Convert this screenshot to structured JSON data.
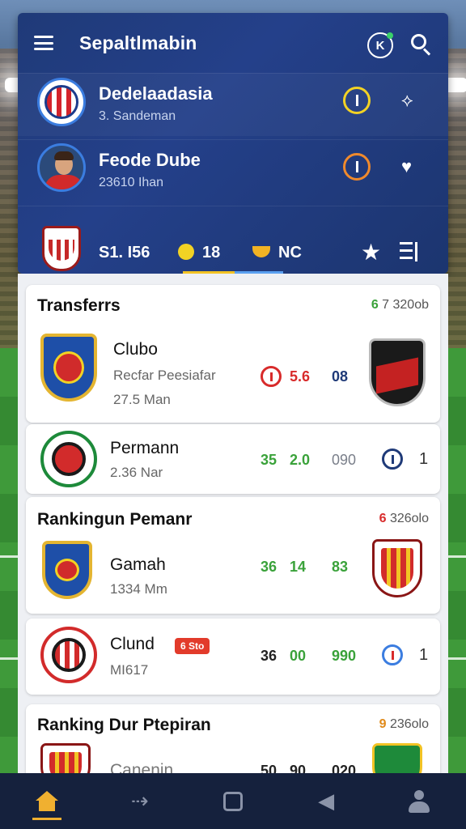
{
  "header": {
    "title": "Sepaltlmabin",
    "notification_glyph": "K",
    "rows": [
      {
        "name": "Dedelaadasia",
        "sub": "3. Sandeman"
      },
      {
        "name": "Feode Dube",
        "sub": "23610 Ihan"
      }
    ],
    "stats": {
      "first": "S1. I56",
      "second": "18",
      "third": "NC"
    }
  },
  "transfers": {
    "title": "Transferrs",
    "count_num": "6",
    "count_rest": " 7 320ob",
    "items": [
      {
        "name": "Clubo",
        "sub": "Recfar Peesiafar",
        "sub2": "27.5 Man",
        "v1": "5.6",
        "v2": "08"
      },
      {
        "name": "Permann",
        "sub": "2.36 Nar",
        "v1": "35",
        "v2": "2.0",
        "v3": "090",
        "right": "1"
      }
    ]
  },
  "ranking": {
    "title": "Rankingun Pemanr",
    "count_num": "6",
    "count_rest": " 326olo",
    "items": [
      {
        "name": "Gamah",
        "sub": "1334 Mm",
        "v1": "36",
        "v2": "14",
        "v3": "83"
      },
      {
        "name": "Clund",
        "badge": "6 Sto",
        "sub": "MI617",
        "v1": "36",
        "v2": "00",
        "v3": "990",
        "right": "1"
      }
    ]
  },
  "ranking2": {
    "title": "Ranking Dur Ptepiran",
    "count_num": "9",
    "count_rest": " 236olo",
    "items": [
      {
        "name": "Canenin",
        "v1": "50",
        "v2": "90",
        "v3": "020"
      }
    ]
  },
  "colors": {
    "header_bg": "#1f3a78",
    "accent_gold": "#f2d224",
    "positive": "#3aa23a",
    "negative": "#d82b2b",
    "nav_bg": "#15213d"
  },
  "bottom_nav": [
    "home-icon",
    "arrow-right-icon",
    "square-icon",
    "megaphone-icon",
    "user-icon"
  ]
}
